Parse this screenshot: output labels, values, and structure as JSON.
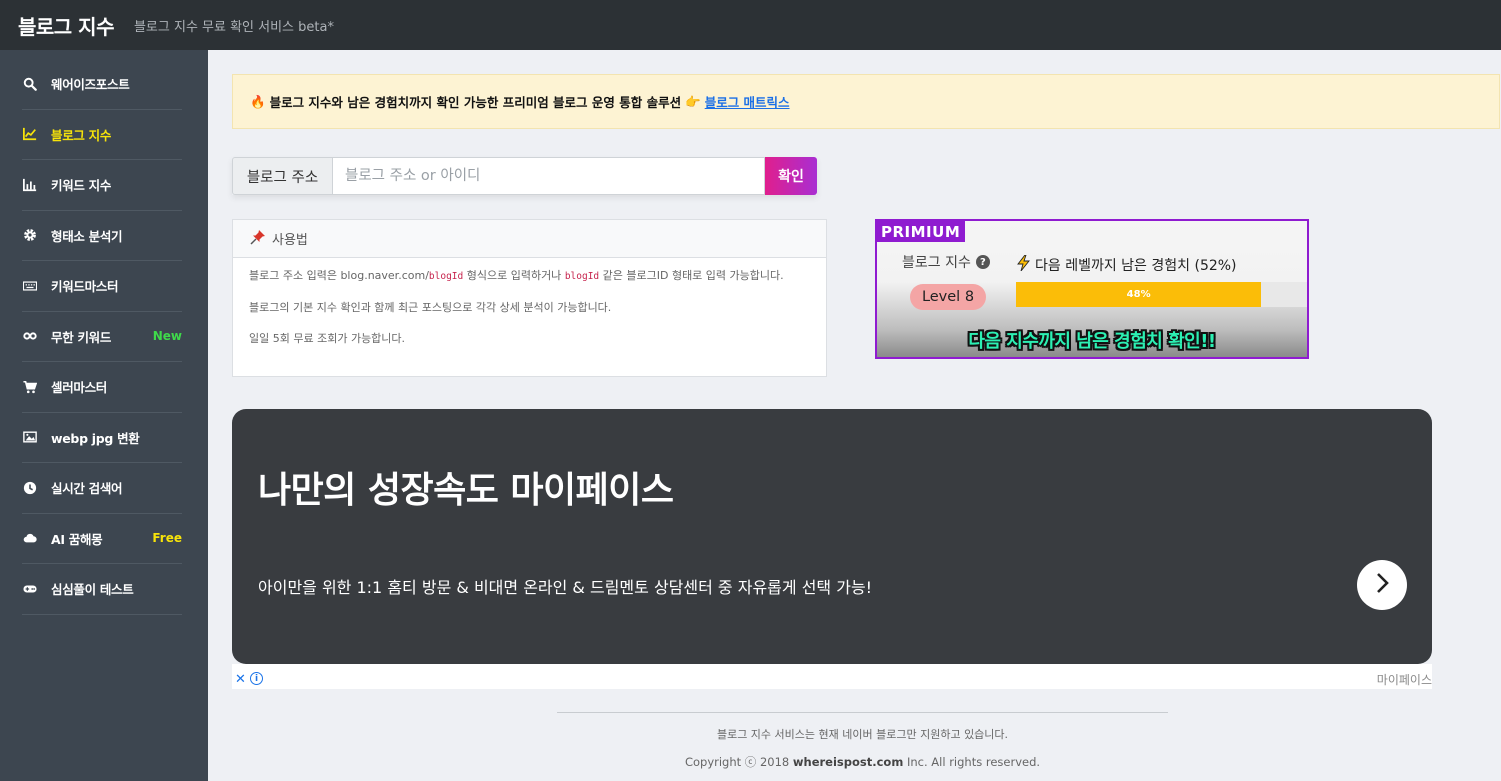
{
  "header": {
    "brand": "블로그 지수",
    "subtitle": "블로그 지수 무료 확인 서비스 beta*"
  },
  "sidebar": {
    "items": [
      {
        "label": "웨어이즈포스트",
        "icon": "search-icon",
        "badge": ""
      },
      {
        "label": "블로그 지수",
        "icon": "line-chart-icon",
        "badge": "",
        "active": true
      },
      {
        "label": "키워드 지수",
        "icon": "bar-chart-icon",
        "badge": ""
      },
      {
        "label": "형태소 분석기",
        "icon": "gear-icon",
        "badge": ""
      },
      {
        "label": "키워드마스터",
        "icon": "keyboard-icon",
        "badge": ""
      },
      {
        "label": "무한 키워드",
        "icon": "infinity-icon",
        "badge": "New"
      },
      {
        "label": "셀러마스터",
        "icon": "cart-icon",
        "badge": ""
      },
      {
        "label": "webp jpg 변환",
        "icon": "image-icon",
        "badge": ""
      },
      {
        "label": "실시간 검색어",
        "icon": "clock-icon",
        "badge": ""
      },
      {
        "label": "AI 꿈해몽",
        "icon": "cloud-icon",
        "badge": "Free"
      },
      {
        "label": "심심풀이 테스트",
        "icon": "gamepad-icon",
        "badge": ""
      }
    ]
  },
  "notice": {
    "text": "블로그 지수와 남은 경험치까지 확인 가능한 프리미엄 블로그 운영 통합 솔루션",
    "link": "블로그 매트릭스"
  },
  "search": {
    "label": "블로그 주소",
    "placeholder": "블로그 주소 or 아이디",
    "button": "확인"
  },
  "usage": {
    "title": "사용법",
    "line1_a": "블로그 주소 입력은 blog.naver.com/",
    "line1_code1": "blogId",
    "line1_b": " 형식으로 입력하거나 ",
    "line1_code2": "blogId",
    "line1_c": " 같은 블로그ID 형태로 입력 가능합니다.",
    "line2": "블로그의 기본 지수 확인과 함께 최근 포스팅으로 각각 상세 분석이 가능합니다.",
    "line3": "일일 5회 무료 조회가 가능합니다."
  },
  "premium": {
    "tag": "PRIMIUM",
    "index_label": "블로그 지수",
    "level": "Level 8",
    "remaining": "다음 레벨까지 남은 경험치 (52%)",
    "progress_text": "48%",
    "progress": 0.84,
    "cta": "다음 지수까지 남은 경험치 확인!!"
  },
  "ad": {
    "title": "나만의 성장속도 마이페이스",
    "description": "아이만을 위한 1:1 홈티 방문 & 비대면 온라인 & 드림멘토 상담센터 중 자유롭게 선택 가능!",
    "source": "마이페이스"
  },
  "footer": {
    "note": "블로그 지수 서비스는 현재 네이버 블로그만 지원하고 있습니다.",
    "copy_prefix": "Copyright ⓒ 2018 ",
    "copy_site": "whereispost.com",
    "copy_suffix": " Inc. All rights reserved."
  }
}
